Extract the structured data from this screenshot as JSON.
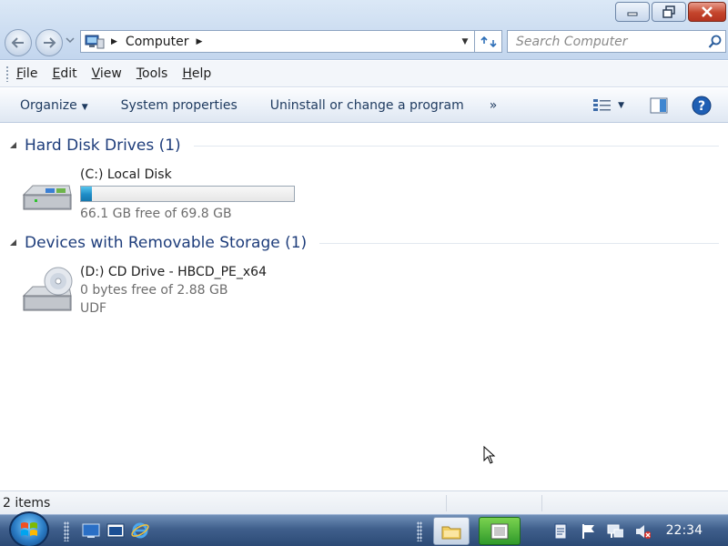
{
  "window": {
    "breadcrumb": "Computer",
    "search_placeholder": "Search Computer"
  },
  "menu": [
    "File",
    "Edit",
    "View",
    "Tools",
    "Help"
  ],
  "menu_access_keys": [
    "F",
    "E",
    "V",
    "T",
    "H"
  ],
  "toolbar": {
    "organize": "Organize",
    "system_properties": "System properties",
    "uninstall": "Uninstall or change a program",
    "more": "»"
  },
  "groups": [
    {
      "title": "Hard Disk Drives (1)",
      "items": [
        {
          "name": "(C:) Local Disk",
          "free_text": "66.1 GB free of 69.8 GB",
          "used_fraction": 0.053
        }
      ]
    },
    {
      "title": "Devices with Removable Storage (1)",
      "items": [
        {
          "name": "(D:) CD Drive - HBCD_PE_x64",
          "free_text": "0 bytes free of 2.88 GB",
          "filesystem": "UDF"
        }
      ]
    }
  ],
  "status": {
    "items": "2 items"
  },
  "taskbar": {
    "clock": "22:34"
  },
  "icons": {
    "back": "back-arrow-icon",
    "forward": "forward-arrow-icon",
    "computer": "computer-icon",
    "refresh": "refresh-icon",
    "search": "magnifier-icon",
    "views": "views-icon",
    "preview_pane": "preview-pane-icon",
    "help": "help-icon",
    "hdd": "hard-disk-icon",
    "cd": "cd-drive-icon"
  },
  "colors": {
    "group_title": "#1e3d7b",
    "progress_fill": "#1f8cc6",
    "close_button": "#c4452c",
    "taskbar": "#3f5f8c"
  }
}
